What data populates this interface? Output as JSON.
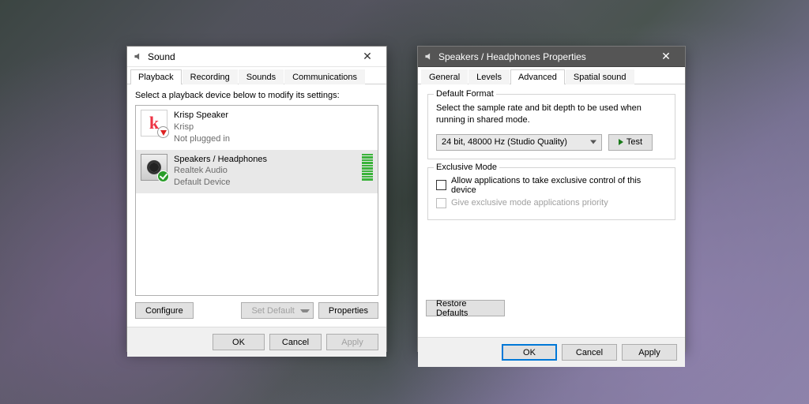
{
  "sound": {
    "title": "Sound",
    "tabs": {
      "playback": "Playback",
      "recording": "Recording",
      "sounds": "Sounds",
      "communications": "Communications"
    },
    "instruction": "Select a playback device below to modify its settings:",
    "devices": [
      {
        "name": "Krisp Speaker",
        "driver": "Krisp",
        "status": "Not plugged in"
      },
      {
        "name": "Speakers / Headphones",
        "driver": "Realtek Audio",
        "status": "Default Device"
      }
    ],
    "buttons": {
      "configure": "Configure",
      "set_default": "Set Default",
      "properties": "Properties"
    },
    "dialog": {
      "ok": "OK",
      "cancel": "Cancel",
      "apply": "Apply"
    }
  },
  "props": {
    "title": "Speakers / Headphones Properties",
    "tabs": {
      "general": "General",
      "levels": "Levels",
      "advanced": "Advanced",
      "spatial": "Spatial sound"
    },
    "default_format": {
      "group": "Default Format",
      "desc": "Select the sample rate and bit depth to be used when running in shared mode.",
      "value": "24 bit, 48000 Hz (Studio Quality)",
      "test": "Test"
    },
    "exclusive": {
      "group": "Exclusive Mode",
      "opt1": "Allow applications to take exclusive control of this device",
      "opt2": "Give exclusive mode applications priority"
    },
    "restore": "Restore Defaults",
    "dialog": {
      "ok": "OK",
      "cancel": "Cancel",
      "apply": "Apply"
    }
  }
}
